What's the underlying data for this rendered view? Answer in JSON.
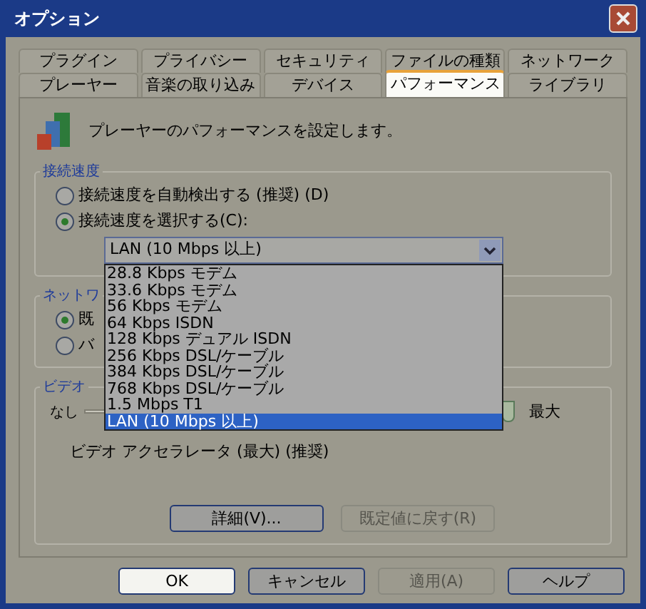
{
  "window": {
    "title": "オプション"
  },
  "tab_rows": [
    [
      {
        "label": "プラグイン",
        "selected": false
      },
      {
        "label": "プライバシー",
        "selected": false
      },
      {
        "label": "セキュリティ",
        "selected": false
      },
      {
        "label": "ファイルの種類",
        "selected": false
      },
      {
        "label": "ネットワーク",
        "selected": false
      }
    ],
    [
      {
        "label": "プレーヤー",
        "selected": false
      },
      {
        "label": "音楽の取り込み",
        "selected": false
      },
      {
        "label": "デバイス",
        "selected": false
      },
      {
        "label": "パフォーマンス",
        "selected": true
      },
      {
        "label": "ライブラリ",
        "selected": false
      }
    ]
  ],
  "description": "プレーヤーのパフォーマンスを設定します。",
  "connection_group": {
    "label": "接続速度",
    "options": [
      {
        "label": "接続速度を自動検出する (推奨) (D)",
        "selected": false
      },
      {
        "label": "接続速度を選択する(C):",
        "selected": true
      }
    ],
    "combo": {
      "value": "LAN (10 Mbps 以上)",
      "expanded": true,
      "options": [
        {
          "label": "28.8 Kbps モデム",
          "selected": false
        },
        {
          "label": "33.6 Kbps モデム",
          "selected": false
        },
        {
          "label": "56 Kbps モデム",
          "selected": false
        },
        {
          "label": "64 Kbps ISDN",
          "selected": false
        },
        {
          "label": "128 Kbps デュアル ISDN",
          "selected": false
        },
        {
          "label": "256 Kbps DSL/ケーブル",
          "selected": false
        },
        {
          "label": "384 Kbps DSL/ケーブル",
          "selected": false
        },
        {
          "label": "768 Kbps DSL/ケーブル",
          "selected": false
        },
        {
          "label": "1.5 Mbps T1",
          "selected": false
        },
        {
          "label": "LAN (10 Mbps 以上)",
          "selected": true
        }
      ]
    }
  },
  "network_group": {
    "label": "ネットワ",
    "options": [
      {
        "label": "既",
        "selected": true
      },
      {
        "label": "バ",
        "selected": false
      }
    ]
  },
  "video_group": {
    "label": "ビデオ",
    "slider": {
      "min_label": "なし",
      "max_label": "最大",
      "level": 1
    },
    "caption": "ビデオ アクセラレータ (最大) (推奨)",
    "buttons": [
      {
        "label": "詳細(V)...",
        "disabled": false
      },
      {
        "label": "既定値に戻す(R)",
        "disabled": true
      }
    ]
  },
  "buttons": [
    {
      "label": "OK",
      "disabled": false,
      "selected": true
    },
    {
      "label": "キャンセル",
      "disabled": false,
      "selected": false
    },
    {
      "label": "適用(A)",
      "disabled": true,
      "selected": false
    },
    {
      "label": "ヘルプ",
      "disabled": false,
      "selected": false
    }
  ]
}
